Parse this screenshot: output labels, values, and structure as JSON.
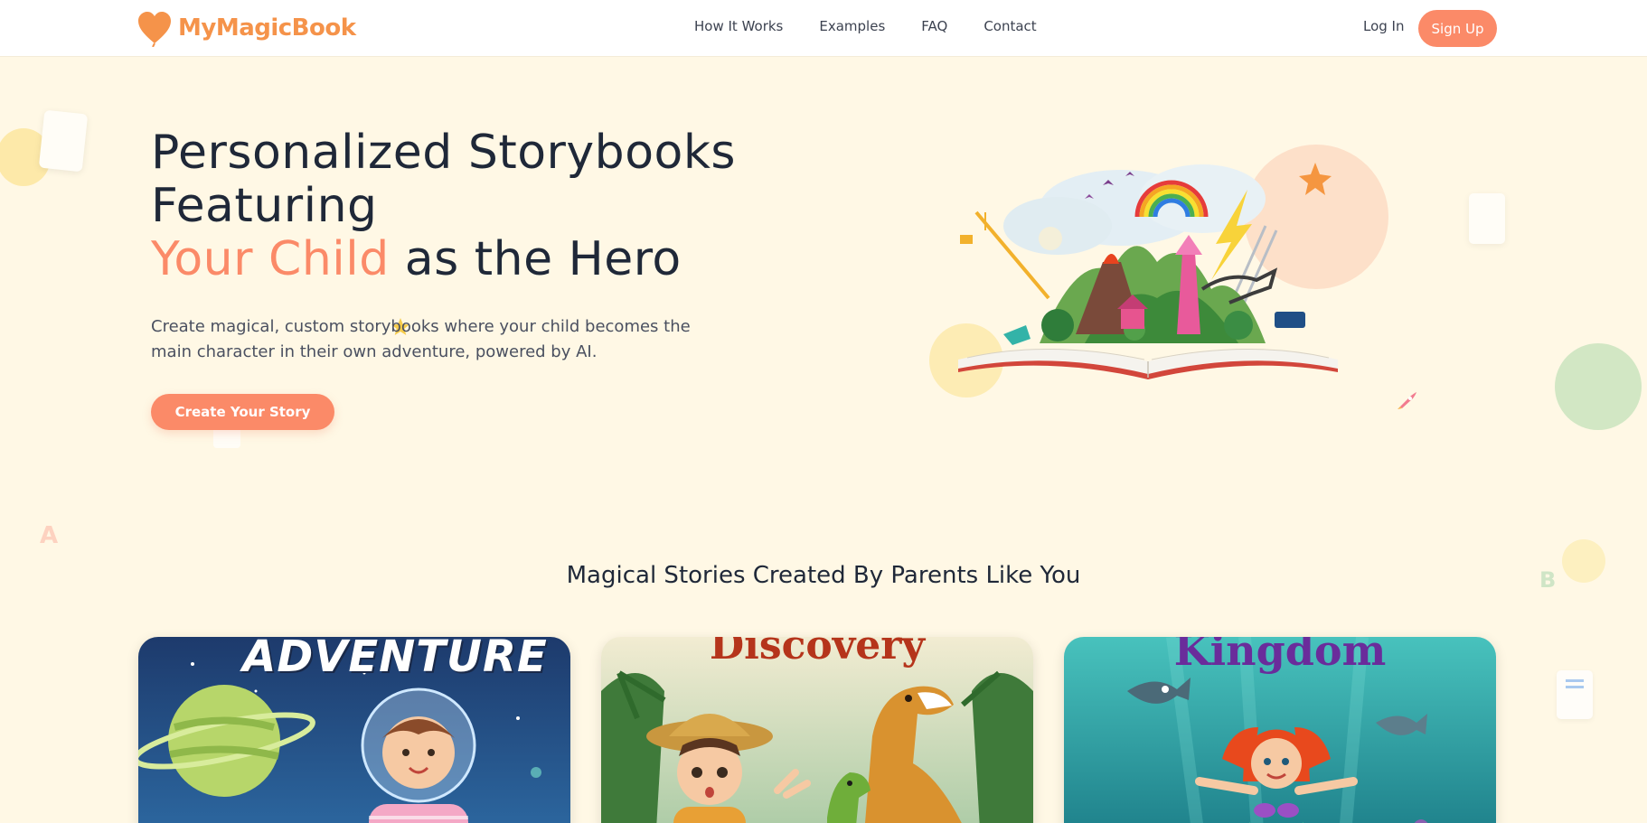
{
  "brand": {
    "name": "MyMagicBook"
  },
  "nav": {
    "links": [
      "How It Works",
      "Examples",
      "FAQ",
      "Contact"
    ],
    "login": "Log In",
    "signup": "Sign Up"
  },
  "hero": {
    "title_line1": "Personalized Storybooks",
    "title_line2": "Featuring",
    "title_accent": "Your Child",
    "title_rest": " as the Hero",
    "subtitle": "Create magical, custom storybooks where your child becomes the main character in their own adventure, powered by AI.",
    "cta": "Create Your Story"
  },
  "section": {
    "title": "Magical Stories Created By Parents Like You"
  },
  "books": [
    {
      "cover_text": "ADVENTURE"
    },
    {
      "cover_text": "Discovery"
    },
    {
      "cover_text": "Kingdom"
    }
  ],
  "decor_letters": [
    "A",
    "B"
  ],
  "colors": {
    "accent": "#fb8a68",
    "logo": "#f5934a",
    "background": "#fff8e5",
    "heading": "#1f2838"
  }
}
